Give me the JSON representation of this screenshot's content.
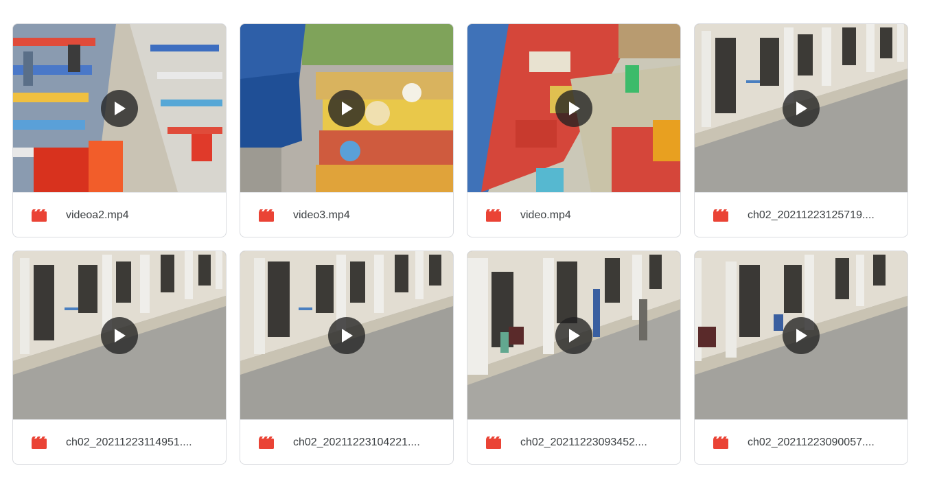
{
  "colors": {
    "video_icon": "#ea4335",
    "play_overlay": "#212121",
    "file_name_text": "#3c4043",
    "card_border": "#dadce0"
  },
  "files": [
    {
      "name": "videoa2.mp4",
      "type_icon": "video-file-icon",
      "thumbnail": "store-aisle-shelves"
    },
    {
      "name": "video3.mp4",
      "type_icon": "video-file-icon",
      "thumbnail": "outdoor-market-stall"
    },
    {
      "name": "video.mp4",
      "type_icon": "video-file-icon",
      "thumbnail": "store-overhead-shelves"
    },
    {
      "name": "ch02_20211223125719....",
      "type_icon": "video-file-icon",
      "thumbnail": "courtyard-building"
    },
    {
      "name": "ch02_20211223114951....",
      "type_icon": "video-file-icon",
      "thumbnail": "courtyard-building"
    },
    {
      "name": "ch02_20211223104221....",
      "type_icon": "video-file-icon",
      "thumbnail": "courtyard-building"
    },
    {
      "name": "ch02_20211223093452....",
      "type_icon": "video-file-icon",
      "thumbnail": "courtyard-building-people"
    },
    {
      "name": "ch02_20211223090057....",
      "type_icon": "video-file-icon",
      "thumbnail": "courtyard-building-person"
    }
  ]
}
